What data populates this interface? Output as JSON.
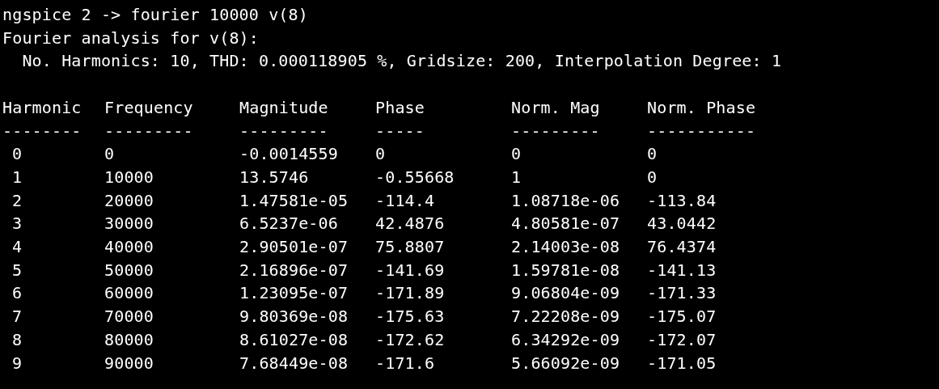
{
  "terminal": {
    "lines": [
      "ngspice 2 -> fourier 10000 v(8)",
      "Fourier analysis for v(8):",
      "  No. Harmonics: 10, THD: 0.000118905 %, Gridsize: 200, Interpolation Degree: 1"
    ],
    "table": {
      "columns": [
        "Harmonic",
        "Frequency",
        "Magnitude",
        "Phase",
        "Norm. Mag",
        "Norm. Phase"
      ],
      "underlines": [
        "--------",
        "---------",
        "---------",
        "-----",
        "---------",
        "-----------"
      ],
      "rows": [
        [
          "0",
          "0",
          "-0.0014559",
          "0",
          "0",
          "0"
        ],
        [
          "1",
          "10000",
          "13.5746",
          "-0.55668",
          "1",
          "0"
        ],
        [
          "2",
          "20000",
          "1.47581e-05",
          "-114.4",
          "1.08718e-06",
          "-113.84"
        ],
        [
          "3",
          "30000",
          "6.5237e-06",
          "42.4876",
          "4.80581e-07",
          "43.0442"
        ],
        [
          "4",
          "40000",
          "2.90501e-07",
          "75.8807",
          "2.14003e-08",
          "76.4374"
        ],
        [
          "5",
          "50000",
          "2.16896e-07",
          "-141.69",
          "1.59781e-08",
          "-141.13"
        ],
        [
          "6",
          "60000",
          "1.23095e-07",
          "-171.89",
          "9.06804e-09",
          "-171.33"
        ],
        [
          "7",
          "70000",
          "9.80369e-08",
          "-175.63",
          "7.22208e-09",
          "-175.07"
        ],
        [
          "8",
          "80000",
          "8.61027e-08",
          "-172.62",
          "6.34292e-09",
          "-172.07"
        ],
        [
          "9",
          "90000",
          "7.68449e-08",
          "-171.6",
          "5.66092e-09",
          "-171.05"
        ]
      ]
    }
  }
}
